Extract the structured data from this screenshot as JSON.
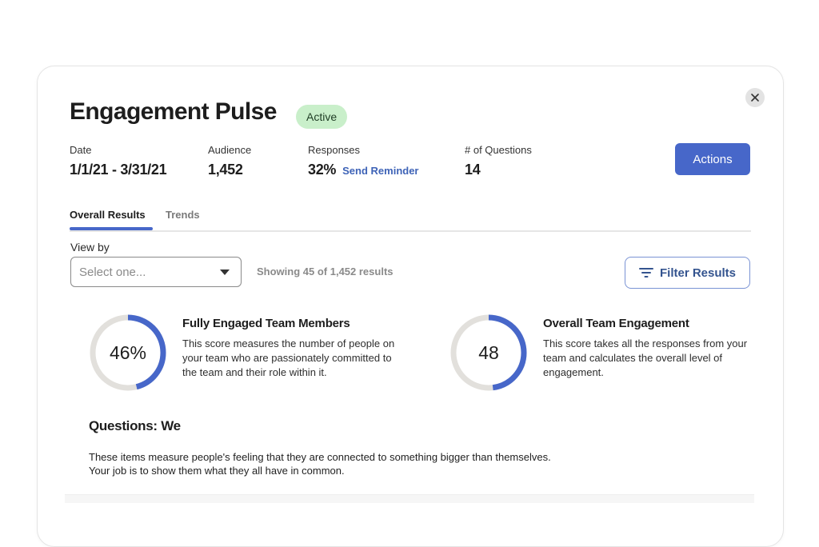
{
  "dialog": {
    "title": "Engagement Pulse",
    "status_badge": "Active",
    "close_icon": "close-icon"
  },
  "meta": {
    "date": {
      "label": "Date",
      "value": "1/1/21 - 3/31/21"
    },
    "audience": {
      "label": "Audience",
      "value": "1,452"
    },
    "responses": {
      "label": "Responses",
      "value": "32%",
      "link": "Send Reminder"
    },
    "questions": {
      "label": "# of Questions",
      "value": "14"
    }
  },
  "actions_button": "Actions",
  "tabs": [
    {
      "label": "Overall Results",
      "active": true
    },
    {
      "label": "Trends",
      "active": false
    }
  ],
  "view_by": {
    "label": "View by",
    "placeholder": "Select one...",
    "showing": "Showing 45 of 1,452 results"
  },
  "filter_button": {
    "label": "Filter Results",
    "icon": "filter-icon"
  },
  "metrics": [
    {
      "value": "46%",
      "fraction": 0.46,
      "title": "Fully Engaged Team Members",
      "description": "This score measures the number of people on your team who are passionately committed to the team and their role within it."
    },
    {
      "value": "48",
      "fraction": 0.48,
      "title": "Overall Team Engagement",
      "description": "This score takes all the responses from your team and calculates the overall level of engagement."
    }
  ],
  "questions_section": {
    "title": "Questions: We",
    "description": "These items measure people's feeling that they are connected to something bigger than themselves. Your job is to show them what they all have in common."
  },
  "colors": {
    "accent": "#4767c9",
    "badge_bg": "#c9efca",
    "ring_track": "#e2e0dc"
  }
}
